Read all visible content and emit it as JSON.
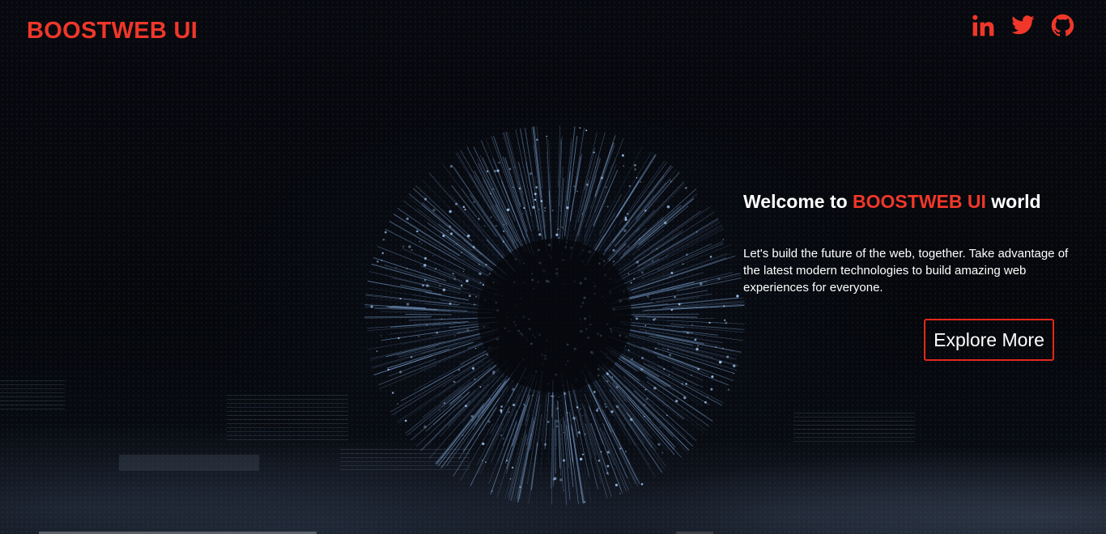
{
  "brand": {
    "name": "BOOSTWEB UI"
  },
  "colors": {
    "accent": "#f0372a",
    "background": "#05070b",
    "text": "#ffffff"
  },
  "social": [
    {
      "icon": "linkedin-icon"
    },
    {
      "icon": "twitter-icon"
    },
    {
      "icon": "github-icon"
    }
  ],
  "hero": {
    "heading_prefix": "Welcome to ",
    "heading_accent": "BOOSTWEB UI",
    "heading_suffix": " world",
    "description": "Let's build the future of the web, together. Take advantage of the latest modern technologies to build amazing web experiences for everyone.",
    "cta_label": "Explore More"
  }
}
